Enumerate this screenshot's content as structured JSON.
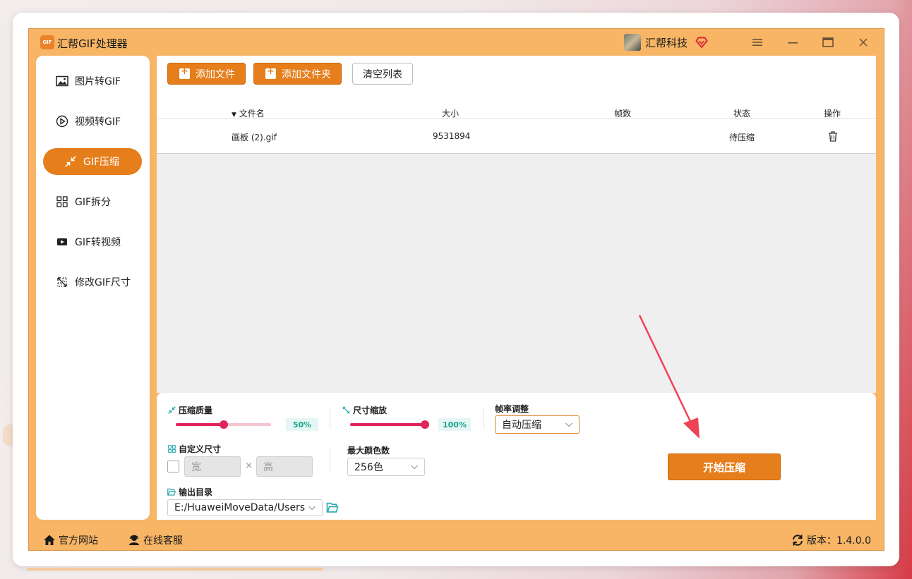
{
  "app": {
    "title": "汇帮GIF处理器",
    "logo_text": "GIF",
    "user_name": "汇帮科技",
    "accent_color": "#e67e1b"
  },
  "sidebar": {
    "items": [
      {
        "label": "图片转GIF",
        "icon": "image-icon"
      },
      {
        "label": "视频转GIF",
        "icon": "play-circle-icon"
      },
      {
        "label": "GIF压缩",
        "icon": "compress-icon"
      },
      {
        "label": "GIF拆分",
        "icon": "split-icon"
      },
      {
        "label": "GIF转视频",
        "icon": "video-icon"
      },
      {
        "label": "修改GIF尺寸",
        "icon": "resize-icon"
      }
    ],
    "active_index": 2
  },
  "toolbar": {
    "add_file": "添加文件",
    "add_folder": "添加文件夹",
    "clear_list": "清空列表"
  },
  "table": {
    "headers": {
      "filename": "文件名",
      "size": "大小",
      "frames": "帧数",
      "status": "状态",
      "actions": "操作"
    },
    "rows": [
      {
        "filename": "画板 (2).gif",
        "size": "9531894",
        "frames": "",
        "status": "待压缩"
      }
    ]
  },
  "settings": {
    "quality_label": "压缩质量",
    "quality_value": "50%",
    "quality_fraction": 0.5,
    "scale_label": "尺寸缩放",
    "scale_value": "100%",
    "scale_fraction": 1.0,
    "framerate_label": "帧率调整",
    "framerate_value": "自动压缩",
    "custom_size_label": "自定义尺寸",
    "width_placeholder": "宽",
    "height_placeholder": "高",
    "times_sign": "×",
    "max_colors_label": "最大颜色数",
    "max_colors_value": "256色",
    "output_label": "输出目录",
    "output_path": "E:/HuaweiMoveData/Users",
    "start_button": "开始压缩"
  },
  "footer": {
    "website": "官方网站",
    "support": "在线客服",
    "version": "版本：1.4.0.0"
  }
}
